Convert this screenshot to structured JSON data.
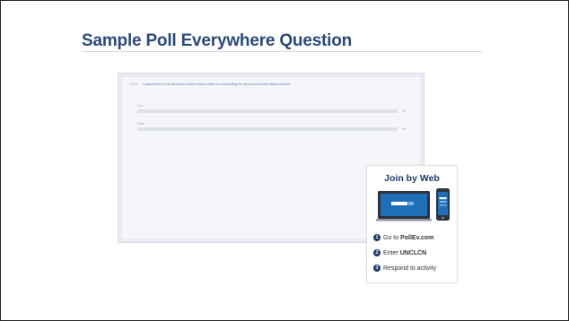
{
  "slide": {
    "title": "Sample Poll Everywhere Question"
  },
  "poll": {
    "question_tag": "Quest..",
    "question": "A spinal tumor is an abnormal mass of tissue within or surrounding the spinal cord and/or spinal column",
    "options": [
      {
        "label": "True",
        "percent": "0%",
        "value": 0
      },
      {
        "label": "False",
        "percent": "0%",
        "value": 0
      }
    ]
  },
  "join": {
    "title": "Join by Web",
    "steps": [
      {
        "num": "1",
        "prefix": "Go to ",
        "bold": "PollEv.com"
      },
      {
        "num": "2",
        "prefix": "Enter ",
        "bold": "UNCLCN"
      },
      {
        "num": "3",
        "prefix": "Respond to activity",
        "bold": ""
      }
    ]
  },
  "colors": {
    "title": "#2a4a7b",
    "accent": "#1f3a68",
    "device_screen": "#1e6fb8"
  }
}
